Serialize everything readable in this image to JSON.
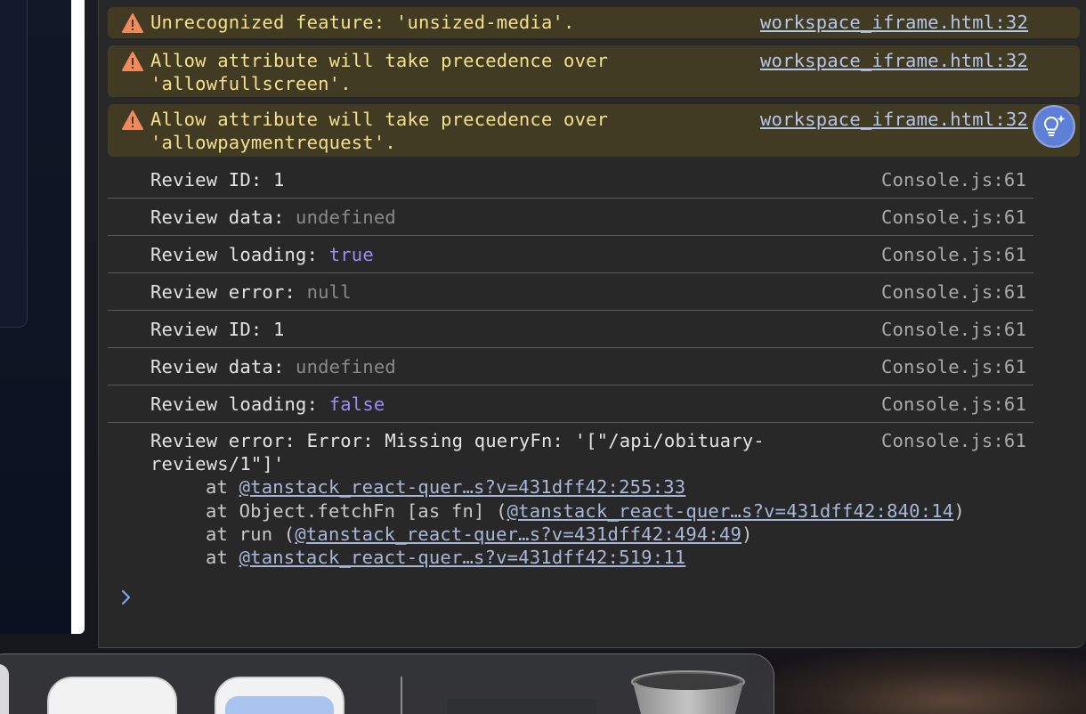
{
  "console": {
    "warnings": [
      {
        "text": "Unrecognized feature: 'unsized-media'.",
        "source": "workspace_iframe.html:32"
      },
      {
        "line1": "Allow attribute will take precedence over",
        "line2": "'allowfullscreen'.",
        "source": "workspace_iframe.html:32"
      },
      {
        "line1": "Allow attribute will take precedence over",
        "line2": "'allowpaymentrequest'.",
        "source": "workspace_iframe.html:32"
      }
    ],
    "logs": [
      {
        "label": "Review ID: ",
        "value": "1",
        "value_style": "plain",
        "source": "Console.js:61"
      },
      {
        "label": "Review data: ",
        "value": "undefined",
        "value_style": "gray",
        "source": "Console.js:61"
      },
      {
        "label": "Review loading: ",
        "value": "true",
        "value_style": "purple",
        "source": "Console.js:61"
      },
      {
        "label": "Review error: ",
        "value": "null",
        "value_style": "gray",
        "source": "Console.js:61"
      },
      {
        "label": "Review ID: ",
        "value": "1",
        "value_style": "plain",
        "source": "Console.js:61"
      },
      {
        "label": "Review data: ",
        "value": "undefined",
        "value_style": "gray",
        "source": "Console.js:61"
      },
      {
        "label": "Review loading: ",
        "value": "false",
        "value_style": "purple",
        "source": "Console.js:61"
      }
    ],
    "error_log": {
      "line1": "Review error: Error: Missing queryFn: '[\"/api/obituary-",
      "line2": "reviews/1\"]'",
      "source": "Console.js:61",
      "stack": [
        {
          "prefix": "at ",
          "link": "@tanstack_react-quer…s?v=431dff42:255:33",
          "suffix": ""
        },
        {
          "prefix": "at Object.fetchFn [as fn] (",
          "link": "@tanstack_react-quer…s?v=431dff42:840:14",
          "suffix": ")"
        },
        {
          "prefix": "at run (",
          "link": "@tanstack_react-quer…s?v=431dff42:494:49",
          "suffix": ")"
        },
        {
          "prefix": "at ",
          "link": "@tanstack_react-quer…s?v=431dff42:519:11",
          "suffix": ""
        }
      ]
    }
  },
  "icons": {
    "warning": "warning-triangle-icon",
    "prompt": "chevron-right-icon",
    "ai": "lightbulb-sparkle-icon",
    "trash": "trash-icon"
  },
  "colors": {
    "console_bg": "#282828",
    "warning_bg": "#413b23",
    "warning_text": "#f4e08c",
    "boolean_value": "#9d8cf5",
    "muted_value": "#8a8a8a"
  }
}
